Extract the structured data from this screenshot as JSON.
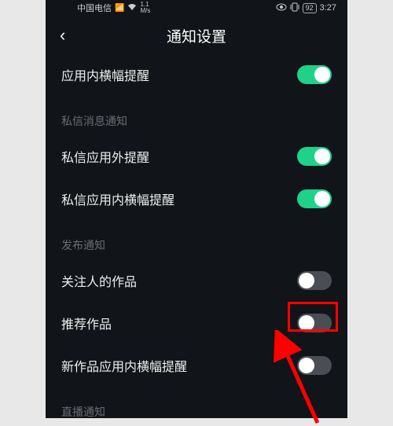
{
  "status": {
    "carrier": "中国电信",
    "signal": "⁴⁶",
    "wifi": "⁴⁶",
    "speed_top": "1.1",
    "speed_bot": "M/s",
    "eye": "👁",
    "vibrate": "❚▯❚",
    "battery": "92",
    "time": "3:27"
  },
  "header": {
    "back": "‹",
    "title": "通知设置"
  },
  "rows": {
    "banner_in_app": "应用内横幅提醒",
    "section_dm": "私信消息通知",
    "dm_external": "私信应用外提醒",
    "dm_banner": "私信应用内横幅提醒",
    "section_publish": "发布通知",
    "follow_works": "关注人的作品",
    "recommend_works": "推荐作品",
    "new_works_banner": "新作品应用内横幅提醒",
    "section_live": "直播通知"
  }
}
